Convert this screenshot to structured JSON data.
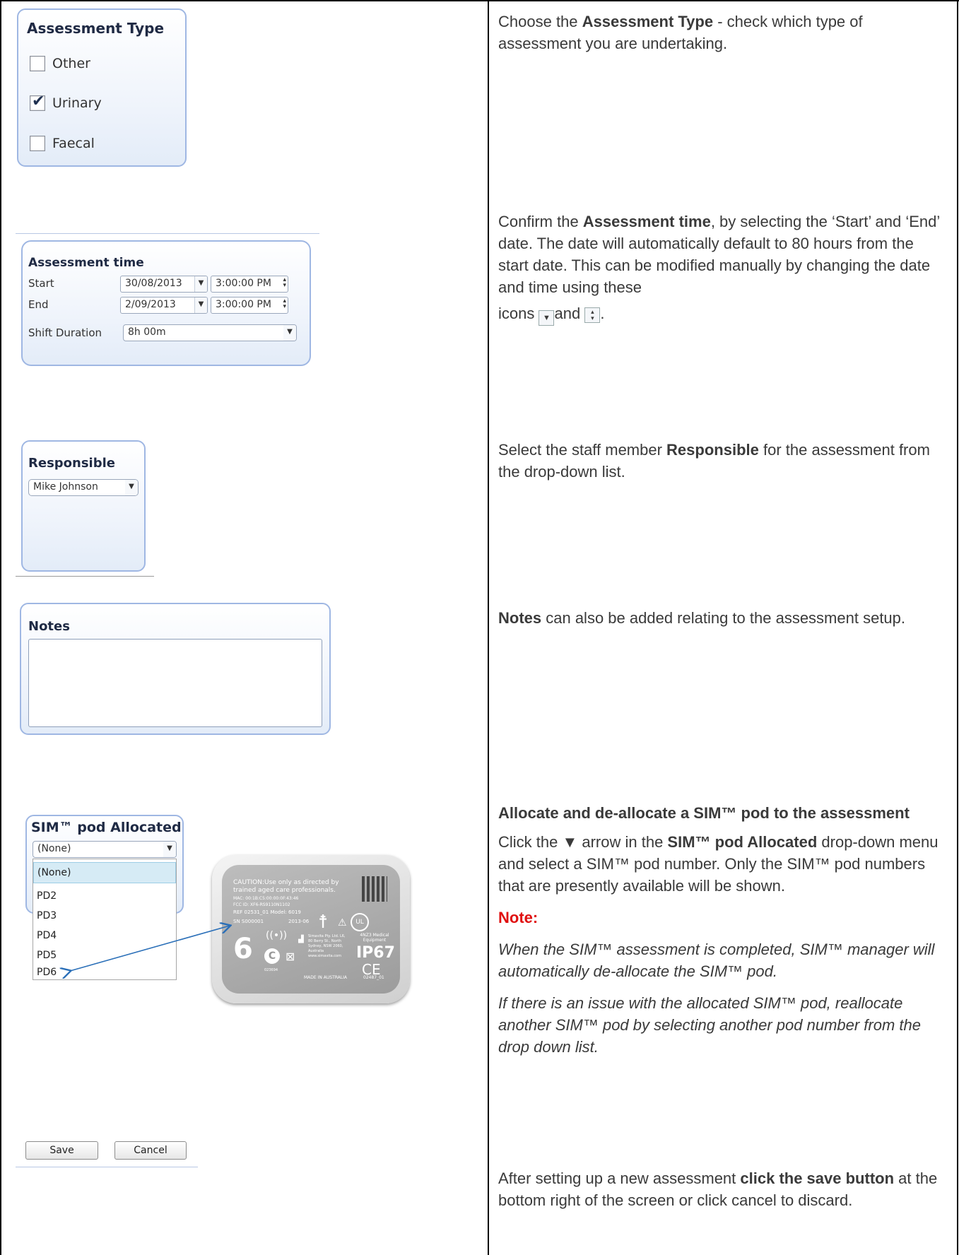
{
  "assessment_type": {
    "title": "Assessment Type",
    "options": [
      {
        "label": "Other",
        "checked": false
      },
      {
        "label": "Urinary",
        "checked": true
      },
      {
        "label": "Faecal",
        "checked": false
      }
    ],
    "desc_pre": "Choose the ",
    "desc_bold": "Assessment Type",
    "desc_post": " - check which type of assessment you are undertaking."
  },
  "assessment_time": {
    "title": "Assessment time",
    "start_label": "Start",
    "start_date": "30/08/2013",
    "start_time": "3:00:00 PM",
    "end_label": "End",
    "end_date": "2/09/2013",
    "end_time": "3:00:00 PM",
    "shift_label": "Shift Duration",
    "shift_value": "8h 00m",
    "desc_pre": "Confirm the ",
    "desc_bold": "Assessment time",
    "desc_post": ", by selecting the ‘Start’ and ‘End’ date. The date will automatically default to 80 hours from the start date. This can be modified manually by changing the date and time using these",
    "desc_icons_pre": "icons ",
    "desc_and": "and",
    "desc_end": "."
  },
  "responsible": {
    "title": "Responsible",
    "value": "Mike Johnson",
    "desc_pre": "Select the staff member ",
    "desc_bold": "Responsible",
    "desc_post": " for the assessment from the drop-down list."
  },
  "notes": {
    "title": "Notes",
    "desc_bold": "Notes",
    "desc_post": " can also be added relating to the assessment setup."
  },
  "sim_pod": {
    "title": "SIM™ pod Allocated",
    "selected": "(None)",
    "items": [
      "(None)",
      "PD2",
      "PD3",
      "PD4",
      "PD5",
      "PD6"
    ],
    "heading": "Allocate and de-allocate a SIM™ pod to the assessment",
    "p1_pre": "Click the ▼ arrow in the ",
    "p1_bold": "SIM™ pod Allocated",
    "p1_post": " drop-down menu and select a SIM™ pod number. Only the SIM™ pod numbers that are presently available will be shown.",
    "note_label": "Note:",
    "note1": "When the SIM™ assessment is completed, SIM™ manager will automatically de-allocate the SIM™ pod.",
    "note2": "If there is an issue with the allocated SIM™ pod, reallocate another SIM™ pod by selecting another pod number from the drop down list."
  },
  "device": {
    "caution": "CAUTION:Use only as directed by trained aged care professionals.",
    "mac": "MAC: 00:1B:C5:00:00:0F:43:46",
    "fcc": "FCC ID: XF6-RS9110N1102",
    "ref": "REF 02531_01  Model: 6019",
    "sn": "SN S000001",
    "date": "2013-06",
    "digit": "6",
    "company": "Simavita Pty. Ltd. L6, 80 Berry St., North Sydney, NSW 2060, Australia www.simavita.com",
    "ip": "IP67",
    "ce": "CE",
    "ul": "UL",
    "code": "4NZ3 Medical Equipment",
    "made": "MADE IN AUSTRALIA",
    "part": "02487_01",
    "serial2": "023694"
  },
  "actions": {
    "save": "Save",
    "cancel": "Cancel",
    "desc_pre": "After setting up a new assessment ",
    "desc_bold": "click the save button",
    "desc_post": " at the bottom right of the screen or click cancel to discard."
  }
}
